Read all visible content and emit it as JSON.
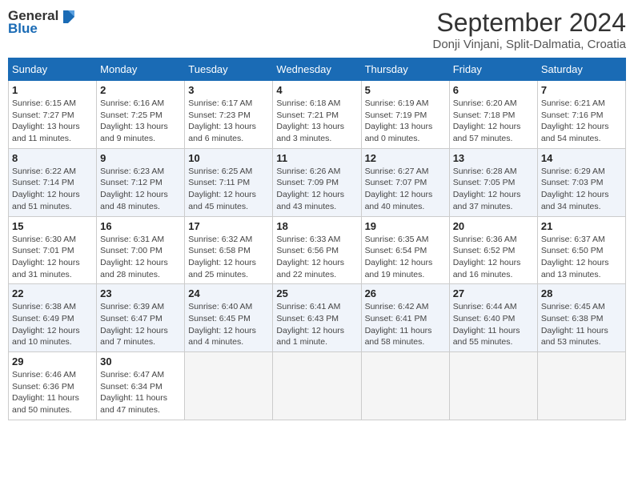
{
  "header": {
    "title": "September 2024",
    "location": "Donji Vinjani, Split-Dalmatia, Croatia",
    "logo_line1": "General",
    "logo_line2": "Blue"
  },
  "weekdays": [
    "Sunday",
    "Monday",
    "Tuesday",
    "Wednesday",
    "Thursday",
    "Friday",
    "Saturday"
  ],
  "weeks": [
    [
      {
        "day": "1",
        "info": "Sunrise: 6:15 AM\nSunset: 7:27 PM\nDaylight: 13 hours and 11 minutes."
      },
      {
        "day": "2",
        "info": "Sunrise: 6:16 AM\nSunset: 7:25 PM\nDaylight: 13 hours and 9 minutes."
      },
      {
        "day": "3",
        "info": "Sunrise: 6:17 AM\nSunset: 7:23 PM\nDaylight: 13 hours and 6 minutes."
      },
      {
        "day": "4",
        "info": "Sunrise: 6:18 AM\nSunset: 7:21 PM\nDaylight: 13 hours and 3 minutes."
      },
      {
        "day": "5",
        "info": "Sunrise: 6:19 AM\nSunset: 7:19 PM\nDaylight: 13 hours and 0 minutes."
      },
      {
        "day": "6",
        "info": "Sunrise: 6:20 AM\nSunset: 7:18 PM\nDaylight: 12 hours and 57 minutes."
      },
      {
        "day": "7",
        "info": "Sunrise: 6:21 AM\nSunset: 7:16 PM\nDaylight: 12 hours and 54 minutes."
      }
    ],
    [
      {
        "day": "8",
        "info": "Sunrise: 6:22 AM\nSunset: 7:14 PM\nDaylight: 12 hours and 51 minutes."
      },
      {
        "day": "9",
        "info": "Sunrise: 6:23 AM\nSunset: 7:12 PM\nDaylight: 12 hours and 48 minutes."
      },
      {
        "day": "10",
        "info": "Sunrise: 6:25 AM\nSunset: 7:11 PM\nDaylight: 12 hours and 45 minutes."
      },
      {
        "day": "11",
        "info": "Sunrise: 6:26 AM\nSunset: 7:09 PM\nDaylight: 12 hours and 43 minutes."
      },
      {
        "day": "12",
        "info": "Sunrise: 6:27 AM\nSunset: 7:07 PM\nDaylight: 12 hours and 40 minutes."
      },
      {
        "day": "13",
        "info": "Sunrise: 6:28 AM\nSunset: 7:05 PM\nDaylight: 12 hours and 37 minutes."
      },
      {
        "day": "14",
        "info": "Sunrise: 6:29 AM\nSunset: 7:03 PM\nDaylight: 12 hours and 34 minutes."
      }
    ],
    [
      {
        "day": "15",
        "info": "Sunrise: 6:30 AM\nSunset: 7:01 PM\nDaylight: 12 hours and 31 minutes."
      },
      {
        "day": "16",
        "info": "Sunrise: 6:31 AM\nSunset: 7:00 PM\nDaylight: 12 hours and 28 minutes."
      },
      {
        "day": "17",
        "info": "Sunrise: 6:32 AM\nSunset: 6:58 PM\nDaylight: 12 hours and 25 minutes."
      },
      {
        "day": "18",
        "info": "Sunrise: 6:33 AM\nSunset: 6:56 PM\nDaylight: 12 hours and 22 minutes."
      },
      {
        "day": "19",
        "info": "Sunrise: 6:35 AM\nSunset: 6:54 PM\nDaylight: 12 hours and 19 minutes."
      },
      {
        "day": "20",
        "info": "Sunrise: 6:36 AM\nSunset: 6:52 PM\nDaylight: 12 hours and 16 minutes."
      },
      {
        "day": "21",
        "info": "Sunrise: 6:37 AM\nSunset: 6:50 PM\nDaylight: 12 hours and 13 minutes."
      }
    ],
    [
      {
        "day": "22",
        "info": "Sunrise: 6:38 AM\nSunset: 6:49 PM\nDaylight: 12 hours and 10 minutes."
      },
      {
        "day": "23",
        "info": "Sunrise: 6:39 AM\nSunset: 6:47 PM\nDaylight: 12 hours and 7 minutes."
      },
      {
        "day": "24",
        "info": "Sunrise: 6:40 AM\nSunset: 6:45 PM\nDaylight: 12 hours and 4 minutes."
      },
      {
        "day": "25",
        "info": "Sunrise: 6:41 AM\nSunset: 6:43 PM\nDaylight: 12 hours and 1 minute."
      },
      {
        "day": "26",
        "info": "Sunrise: 6:42 AM\nSunset: 6:41 PM\nDaylight: 11 hours and 58 minutes."
      },
      {
        "day": "27",
        "info": "Sunrise: 6:44 AM\nSunset: 6:40 PM\nDaylight: 11 hours and 55 minutes."
      },
      {
        "day": "28",
        "info": "Sunrise: 6:45 AM\nSunset: 6:38 PM\nDaylight: 11 hours and 53 minutes."
      }
    ],
    [
      {
        "day": "29",
        "info": "Sunrise: 6:46 AM\nSunset: 6:36 PM\nDaylight: 11 hours and 50 minutes."
      },
      {
        "day": "30",
        "info": "Sunrise: 6:47 AM\nSunset: 6:34 PM\nDaylight: 11 hours and 47 minutes."
      },
      {
        "day": "",
        "info": ""
      },
      {
        "day": "",
        "info": ""
      },
      {
        "day": "",
        "info": ""
      },
      {
        "day": "",
        "info": ""
      },
      {
        "day": "",
        "info": ""
      }
    ]
  ]
}
